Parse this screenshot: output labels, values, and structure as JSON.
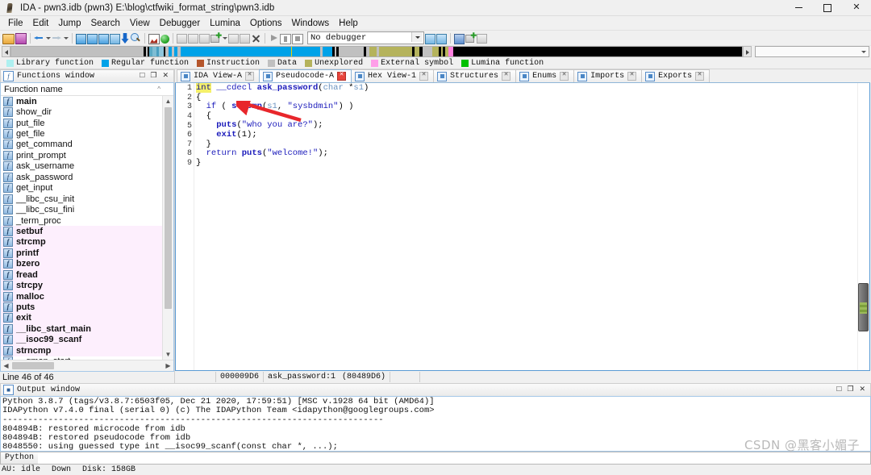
{
  "window": {
    "title": "IDA - pwn3.idb (pwn3) E:\\blog\\ctfwiki_format_string\\pwn3.idb",
    "app_icon": "ida-icon",
    "controls": {
      "minimize": "minimize-icon",
      "maximize": "maximize-icon",
      "close": "close-icon"
    }
  },
  "menu": {
    "items": [
      "File",
      "Edit",
      "Jump",
      "Search",
      "View",
      "Debugger",
      "Lumina",
      "Options",
      "Windows",
      "Help"
    ]
  },
  "toolbar": {
    "debugger_selector": "No debugger",
    "icons": [
      "open-file-icon",
      "save-icon",
      "back-arrow-icon",
      "back-dropdown-icon",
      "forward-arrow-icon",
      "forward-dropdown-icon",
      "rename-icon",
      "rename2-icon",
      "rename3-icon",
      "undo-icon",
      "jump-down-icon",
      "search-icon",
      "graph-icon",
      "run-to-icon",
      "breakpoint-icon",
      "breakpoint2-icon",
      "breakpoint3-icon",
      "add-breakpoint-icon",
      "breakpoint-dropdown-icon",
      "delete-breakpoint-icon",
      "edit-breakpoint-icon",
      "clear-breakpoints-icon",
      "run-icon",
      "pause-icon",
      "stop-icon",
      "step-into-icon",
      "step-over-icon",
      "options-icon",
      "lumina-push-icon",
      "lumina-pull-icon"
    ]
  },
  "navband": {
    "segments": [
      {
        "color": "#c0c0c0",
        "width": 21.5
      },
      {
        "color": "#000000",
        "width": 0.4
      },
      {
        "color": "#c0c0c0",
        "width": 0.3
      },
      {
        "color": "#000000",
        "width": 0.3
      },
      {
        "color": "#5aa9c4",
        "width": 0.5
      },
      {
        "color": "#7fbdd4",
        "width": 0.6
      },
      {
        "color": "#4a9ec0",
        "width": 0.5
      },
      {
        "color": "#8fc6dc",
        "width": 0.7
      },
      {
        "color": "#000000",
        "width": 0.3
      },
      {
        "color": "#c0c0c0",
        "width": 0.6
      },
      {
        "color": "#00a2e8",
        "width": 0.5
      },
      {
        "color": "#c0c0c0",
        "width": 0.4
      },
      {
        "color": "#00a2e8",
        "width": 0.5
      },
      {
        "color": "#c0c0c0",
        "width": 0.5
      },
      {
        "color": "#00a2e8",
        "width": 18.0
      },
      {
        "color": "#f0d000",
        "width": 0.2
      },
      {
        "color": "#00a2e8",
        "width": 4.5
      },
      {
        "color": "#c0c0c0",
        "width": 0.4
      },
      {
        "color": "#00a2e8",
        "width": 1.6
      },
      {
        "color": "#000000",
        "width": 0.4
      },
      {
        "color": "#c0c0c0",
        "width": 0.3
      },
      {
        "color": "#000000",
        "width": 0.4
      },
      {
        "color": "#c0c0c0",
        "width": 4.0
      },
      {
        "color": "#000000",
        "width": 0.4
      },
      {
        "color": "#c0c0c0",
        "width": 0.6
      },
      {
        "color": "#b5b35c",
        "width": 1.2
      },
      {
        "color": "#c0c0c0",
        "width": 0.4
      },
      {
        "color": "#b5b35c",
        "width": 5.4
      },
      {
        "color": "#000000",
        "width": 0.3
      },
      {
        "color": "#b5b35c",
        "width": 0.8
      },
      {
        "color": "#000000",
        "width": 0.5
      },
      {
        "color": "#c0c0c0",
        "width": 1.6
      },
      {
        "color": "#b5b35c",
        "width": 1.1
      },
      {
        "color": "#000000",
        "width": 0.4
      },
      {
        "color": "#b5b35c",
        "width": 0.3
      },
      {
        "color": "#000000",
        "width": 0.4
      },
      {
        "color": "#b5b35c",
        "width": 0.5
      },
      {
        "color": "#ff7fdf",
        "width": 0.8
      },
      {
        "color": "#000000",
        "width": 47.0
      }
    ]
  },
  "legend": {
    "items": [
      {
        "label": "Library function",
        "color": "#aef0f0"
      },
      {
        "label": "Regular function",
        "color": "#00a2e8"
      },
      {
        "label": "Instruction",
        "color": "#b5562c"
      },
      {
        "label": "Data",
        "color": "#c0c0c0"
      },
      {
        "label": "Unexplored",
        "color": "#b5b35c"
      },
      {
        "label": "External symbol",
        "color": "#ff9ee8"
      },
      {
        "label": "Lumina function",
        "color": "#00c000"
      }
    ]
  },
  "functions_window": {
    "title": "Functions window",
    "column_header": "Function name",
    "status": "Line 46 of 46",
    "rows": [
      {
        "name": "main",
        "library": false,
        "bold": true
      },
      {
        "name": "show_dir",
        "library": false,
        "bold": false
      },
      {
        "name": "put_file",
        "library": false,
        "bold": false
      },
      {
        "name": "get_file",
        "library": false,
        "bold": false
      },
      {
        "name": "get_command",
        "library": false,
        "bold": false
      },
      {
        "name": "print_prompt",
        "library": false,
        "bold": false
      },
      {
        "name": "ask_username",
        "library": false,
        "bold": false
      },
      {
        "name": "ask_password",
        "library": false,
        "bold": false
      },
      {
        "name": "get_input",
        "library": false,
        "bold": false
      },
      {
        "name": "__libc_csu_init",
        "library": false,
        "bold": false
      },
      {
        "name": "__libc_csu_fini",
        "library": false,
        "bold": false
      },
      {
        "name": "_term_proc",
        "library": false,
        "bold": false
      },
      {
        "name": "setbuf",
        "library": true,
        "bold": true
      },
      {
        "name": "strcmp",
        "library": true,
        "bold": true
      },
      {
        "name": "printf",
        "library": true,
        "bold": true
      },
      {
        "name": "bzero",
        "library": true,
        "bold": true
      },
      {
        "name": "fread",
        "library": true,
        "bold": true
      },
      {
        "name": "strcpy",
        "library": true,
        "bold": true
      },
      {
        "name": "malloc",
        "library": true,
        "bold": true
      },
      {
        "name": "puts",
        "library": true,
        "bold": true
      },
      {
        "name": "exit",
        "library": true,
        "bold": true
      },
      {
        "name": "__libc_start_main",
        "library": true,
        "bold": true
      },
      {
        "name": "__isoc99_scanf",
        "library": true,
        "bold": true
      },
      {
        "name": "strncmp",
        "library": true,
        "bold": true
      },
      {
        "name": "__gmon_start__",
        "library": false,
        "bold": false
      }
    ]
  },
  "tabs": [
    {
      "label": "IDA View-A",
      "active": false
    },
    {
      "label": "Pseudocode-A",
      "active": true
    },
    {
      "label": "Hex View-1",
      "active": false
    },
    {
      "label": "Structures",
      "active": false
    },
    {
      "label": "Enums",
      "active": false
    },
    {
      "label": "Imports",
      "active": false
    },
    {
      "label": "Exports",
      "active": false
    }
  ],
  "code": {
    "lines": [
      {
        "num": "1",
        "breakpoint": false,
        "text": "int __cdecl ask_password(char *s1)"
      },
      {
        "num": "2",
        "breakpoint": false,
        "text": "{"
      },
      {
        "num": "3",
        "breakpoint": true,
        "text": "  if ( strcmp(s1, \"sysbdmin\") )"
      },
      {
        "num": "4",
        "breakpoint": false,
        "text": "  {"
      },
      {
        "num": "5",
        "breakpoint": true,
        "text": "    puts(\"who you are?\");"
      },
      {
        "num": "6",
        "breakpoint": true,
        "text": "    exit(1);"
      },
      {
        "num": "7",
        "breakpoint": false,
        "text": "  }"
      },
      {
        "num": "8",
        "breakpoint": true,
        "text": "  return puts(\"welcome!\");"
      },
      {
        "num": "9",
        "breakpoint": true,
        "text": "}"
      }
    ],
    "status_offset": "000009D6",
    "status_location": "ask_password:1",
    "status_address": "(80489D6)"
  },
  "output_window": {
    "title": "Output window",
    "lines": [
      "Python 3.8.7 (tags/v3.8.7:6503f05, Dec 21 2020, 17:59:51) [MSC v.1928 64 bit (AMD64)]",
      "IDAPython v7.4.0 final (serial 0) (c) The IDAPython Team <idapython@googlegroups.com>",
      "---------------------------------------------------------------------------",
      "804894B: restored microcode from idb",
      "804894B: restored pseudocode from idb",
      "8048550: using guessed type int __isoc99_scanf(const char *, ...);"
    ],
    "command_label": "Python",
    "command_value": ""
  },
  "statusbar": {
    "au": "AU: idle",
    "state": "Down",
    "disk": "Disk: 158GB"
  },
  "watermark": "CSDN @黑客小媚子",
  "colors": {
    "accent": "#00a2e8",
    "library_row": "#fdeffd",
    "highlight": "#f5f06a",
    "annotation_arrow": "#e8262b",
    "panel_border": "#5b9bd5"
  }
}
